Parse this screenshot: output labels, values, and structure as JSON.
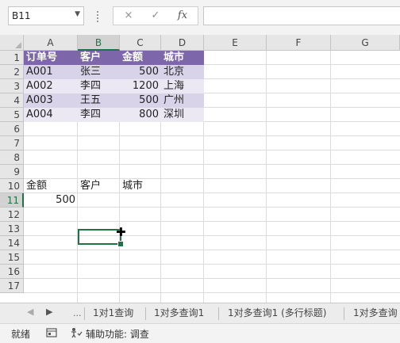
{
  "formula_bar": {
    "name_box": "B11",
    "cancel_icon": "×",
    "confirm_icon": "✓",
    "function_icon": "fx",
    "formula": ""
  },
  "columns": [
    "A",
    "B",
    "C",
    "D",
    "E",
    "F",
    "G"
  ],
  "selected_column": "B",
  "rows": [
    "1",
    "2",
    "3",
    "4",
    "5",
    "6",
    "7",
    "8",
    "9",
    "10",
    "11",
    "12",
    "13",
    "14",
    "15",
    "16",
    "17"
  ],
  "selected_row": "11",
  "table": {
    "headers": [
      "订单号",
      "客户",
      "金额",
      "城市"
    ],
    "rows": [
      [
        "A001",
        "张三",
        "500",
        "北京"
      ],
      [
        "A002",
        "李四",
        "1200",
        "上海"
      ],
      [
        "A003",
        "王五",
        "500",
        "广州"
      ],
      [
        "A004",
        "李四",
        "800",
        "深圳"
      ]
    ]
  },
  "lookup": {
    "labels": [
      "金额",
      "客户",
      "城市"
    ],
    "amount_value": "500"
  },
  "active_cell": "B11",
  "sheet_tabs": {
    "nav_prev": "◀",
    "nav_next": "▶",
    "more": "...",
    "tabs": [
      "1对1查询",
      "1对多查询1",
      "1对多查询1 (多行标题)",
      "1对多查询"
    ]
  },
  "status_bar": {
    "ready": "就绪",
    "accessibility": "辅助功能: 调查"
  },
  "colors": {
    "header_bg": "#7d66a9",
    "band_dark": "#d9d3ea",
    "band_light": "#ebe8f4",
    "selection": "#217346"
  }
}
